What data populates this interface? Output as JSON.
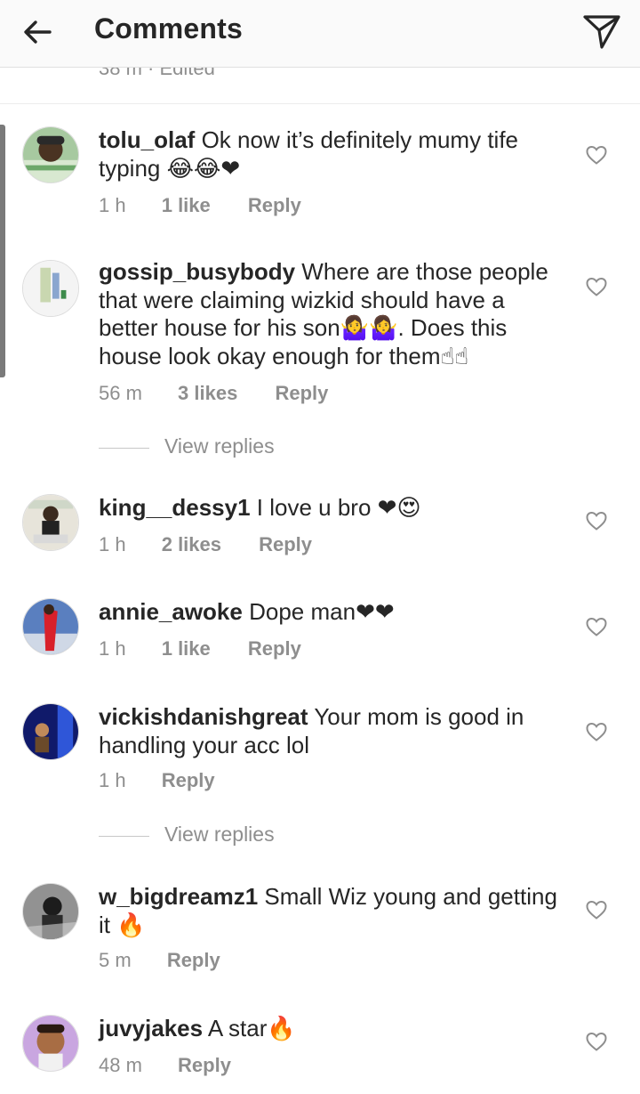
{
  "header": {
    "title": "Comments",
    "back_icon": "arrow-left-icon",
    "send_icon": "paper-plane-icon"
  },
  "previous_meta": "38 m · Edited",
  "view_replies_label": "View replies",
  "comments": [
    {
      "username": "tolu_olaf",
      "text": "Ok now it’s definitely mumy tife typing",
      "emoji": "😂😂❤",
      "time": "1 h",
      "likes": "1 like",
      "reply": "Reply"
    },
    {
      "username": "gossip_busybody",
      "text": "Where are those people that were claiming wizkid should have a better house for his son🤷‍♀️🤷‍♀️. Does this house look okay enough for them☝☝",
      "emoji": "",
      "time": "56 m",
      "likes": "3 likes",
      "reply": "Reply"
    },
    {
      "username": "king__dessy1",
      "text": "I love u bro",
      "emoji": "❤😍",
      "time": "1 h",
      "likes": "2 likes",
      "reply": "Reply"
    },
    {
      "username": "annie_awoke",
      "text": "Dope man",
      "emoji": "❤❤",
      "time": "1 h",
      "likes": "1 like",
      "reply": "Reply"
    },
    {
      "username": "vickishdanishgreat",
      "text": "Your mom is good in handling your acc lol",
      "emoji": "",
      "time": "1 h",
      "likes": "",
      "reply": "Reply"
    },
    {
      "username": "w_bigdreamz1",
      "text": "Small Wiz young and getting it",
      "emoji": "🔥",
      "time": "5 m",
      "likes": "",
      "reply": "Reply"
    },
    {
      "username": "juvyjakes",
      "text": "A star",
      "emoji": "🔥",
      "time": "48 m",
      "likes": "",
      "reply": "Reply"
    }
  ],
  "colors": {
    "text": "#262626",
    "muted": "#8e8e8e",
    "header_bg": "#fafafa"
  }
}
